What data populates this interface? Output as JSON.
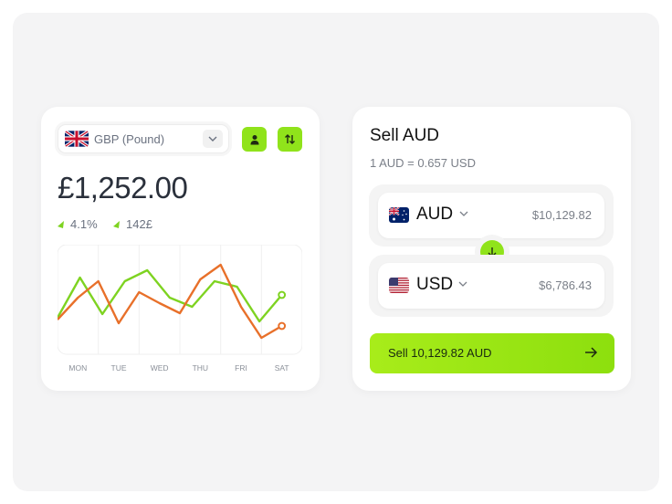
{
  "converter_left": {
    "currency": {
      "label": "GBP (Pound)",
      "flag": "uk-flag"
    },
    "balance": "£1,252.00",
    "stats": [
      {
        "value": "4.1%"
      },
      {
        "value": "142£"
      }
    ],
    "buttons": {
      "user": "user-icon",
      "swap": "swap-vertical-icon"
    }
  },
  "chart_data": {
    "type": "line",
    "categories": [
      "MON",
      "TUE",
      "WED",
      "THU",
      "FRI",
      "SAT"
    ],
    "series": [
      {
        "color": "#7ed321",
        "values": [
          40,
          84,
          44,
          80,
          92,
          62,
          52,
          80,
          74,
          36,
          65
        ]
      },
      {
        "color": "#e8702a",
        "values": [
          38,
          62,
          80,
          34,
          68,
          56,
          45,
          82,
          98,
          52,
          18,
          31
        ]
      }
    ],
    "ylim": [
      0,
      120
    ],
    "grid": true
  },
  "sell_panel": {
    "title": "Sell AUD",
    "rate": "1 AUD = 0.657 USD",
    "from": {
      "code": "AUD",
      "amount": "$10,129.82",
      "flag": "australia-flag"
    },
    "to": {
      "code": "USD",
      "amount": "$6,786.43",
      "flag": "usa-flag"
    },
    "sell_button": "Sell 10,129.82 AUD"
  },
  "colors": {
    "accent": "#90e31b",
    "green_line": "#7ed321",
    "orange_line": "#e8702a"
  }
}
